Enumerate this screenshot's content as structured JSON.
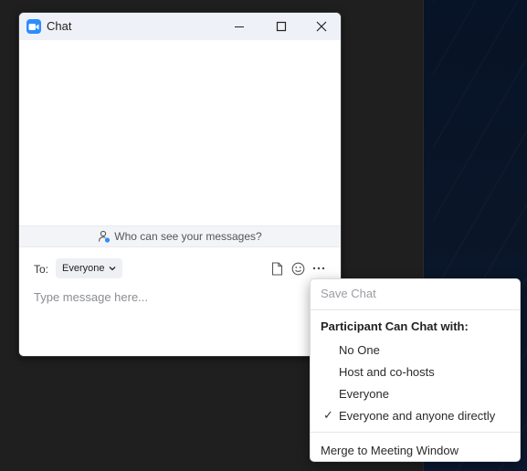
{
  "window": {
    "title": "Chat"
  },
  "chat": {
    "visibility_notice": "Who can see your messages?",
    "to_label": "To:",
    "recipient": "Everyone",
    "message_placeholder": "Type message here..."
  },
  "menu": {
    "save_chat": "Save Chat",
    "heading": "Participant Can Chat with:",
    "options": [
      {
        "label": "No One",
        "checked": false
      },
      {
        "label": "Host and co-hosts",
        "checked": false
      },
      {
        "label": "Everyone",
        "checked": false
      },
      {
        "label": "Everyone and anyone directly",
        "checked": true
      }
    ],
    "check_glyph": "✓",
    "merge": "Merge to Meeting Window"
  },
  "colors": {
    "accent": "#2d8cff",
    "titlebar": "#eef1f7"
  }
}
